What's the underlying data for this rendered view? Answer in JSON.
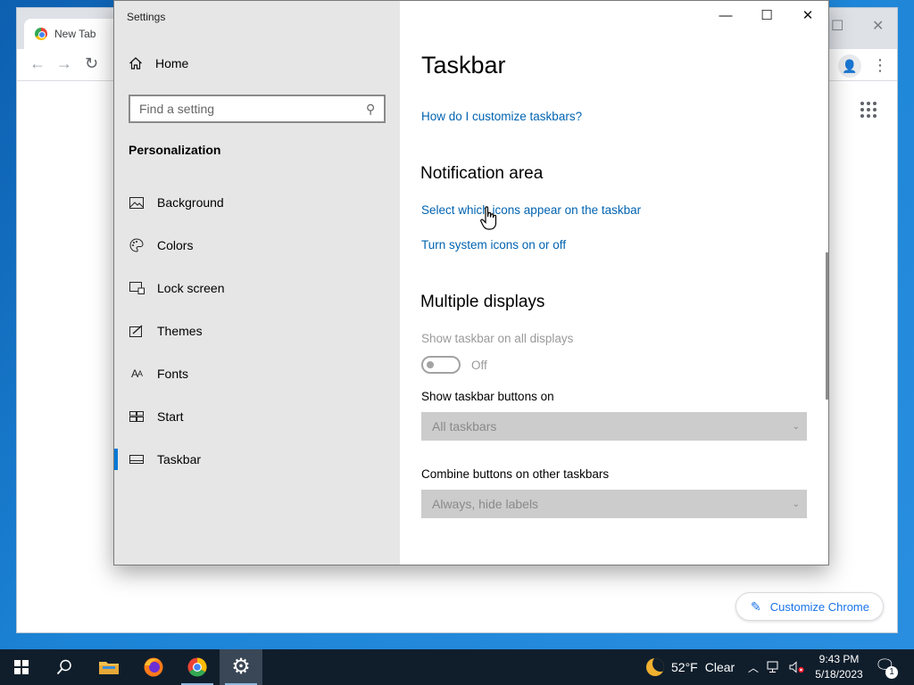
{
  "chrome": {
    "tab_title": "New Tab",
    "customize_label": "Customize Chrome"
  },
  "settings": {
    "window_title": "Settings",
    "sidebar": {
      "home_label": "Home",
      "search_placeholder": "Find a setting",
      "section_heading": "Personalization",
      "items": [
        {
          "label": "Background",
          "icon": "picture-icon"
        },
        {
          "label": "Colors",
          "icon": "palette-icon"
        },
        {
          "label": "Lock screen",
          "icon": "lock-screen-icon"
        },
        {
          "label": "Themes",
          "icon": "themes-icon"
        },
        {
          "label": "Fonts",
          "icon": "fonts-icon"
        },
        {
          "label": "Start",
          "icon": "start-icon"
        },
        {
          "label": "Taskbar",
          "icon": "taskbar-icon",
          "selected": true
        }
      ]
    },
    "content": {
      "title": "Taskbar",
      "help_link": "How do I customize taskbars?",
      "notification_heading": "Notification area",
      "notification_links": [
        "Select which icons appear on the taskbar",
        "Turn system icons on or off"
      ],
      "multiple_displays_heading": "Multiple displays",
      "show_all_displays_label": "Show taskbar on all displays",
      "show_all_displays_state": "Off",
      "buttons_on_label": "Show taskbar buttons on",
      "buttons_on_value": "All taskbars",
      "combine_label": "Combine buttons on other taskbars",
      "combine_value": "Always, hide labels"
    }
  },
  "taskbar": {
    "weather_temp": "52°F",
    "weather_desc": "Clear",
    "time": "9:43 PM",
    "date": "5/18/2023",
    "notification_count": "1"
  },
  "colors": {
    "accent": "#0078d7",
    "link": "#0063b1",
    "taskbar": "#101e2c"
  }
}
